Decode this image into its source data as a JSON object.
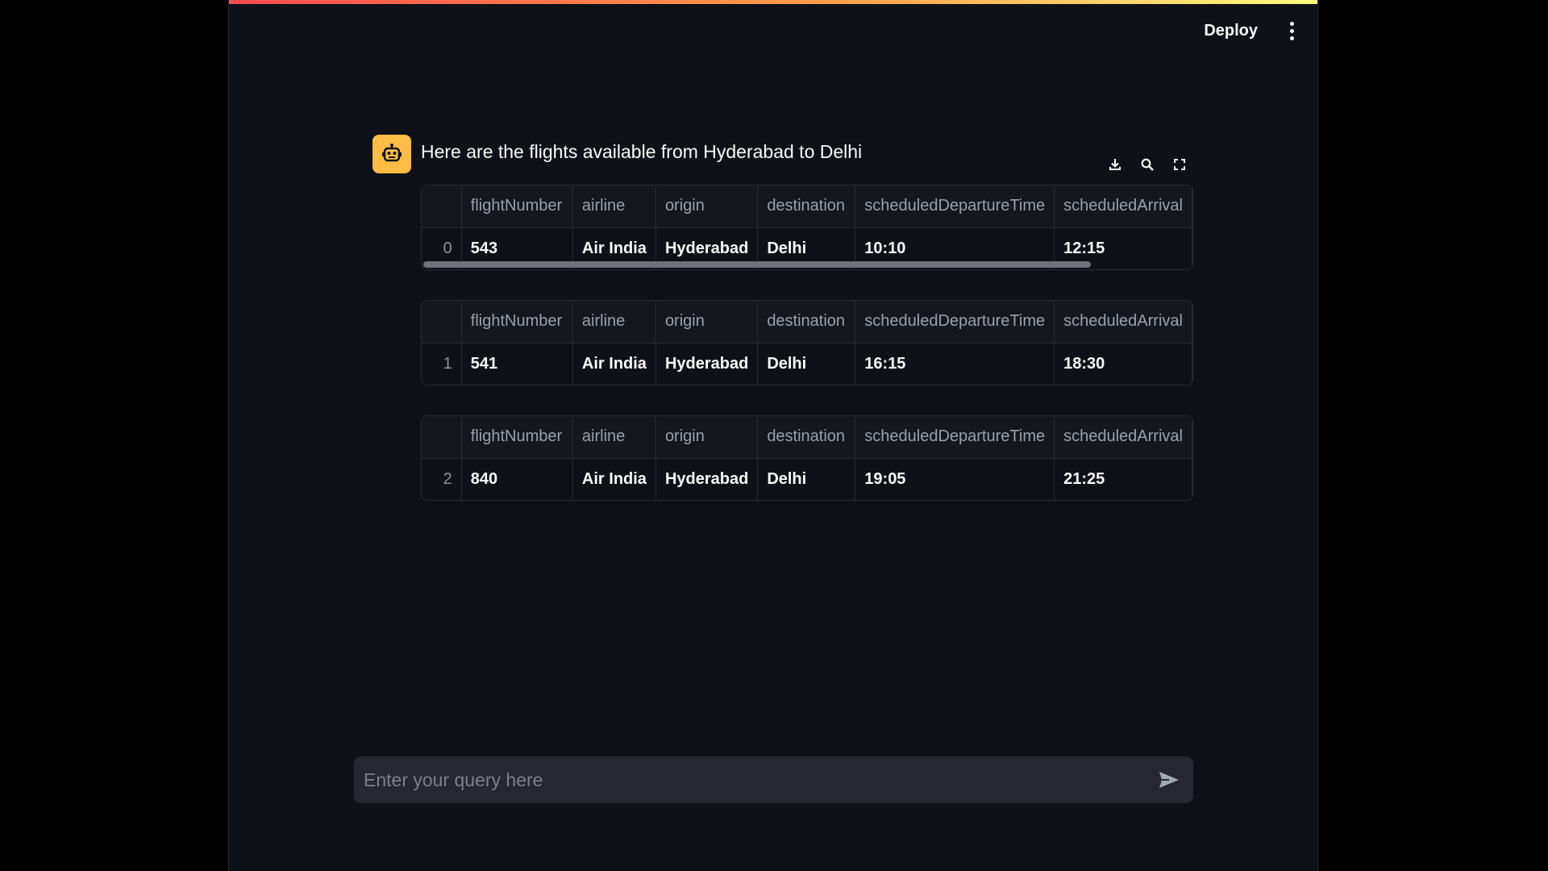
{
  "header": {
    "deploy_label": "Deploy",
    "menu_icon": "kebab-menu-icon"
  },
  "message": {
    "avatar_icon": "robot-icon",
    "text": "Here are the flights available from Hyderabad to Delhi"
  },
  "dataframe_toolbar": {
    "icons": [
      "download-icon",
      "search-icon",
      "fullscreen-icon"
    ]
  },
  "tables": [
    {
      "columns": [
        "",
        "flightNumber",
        "airline",
        "origin",
        "destination",
        "scheduledDepartureTime",
        "scheduledArrival"
      ],
      "row": [
        "0",
        "543",
        "Air India",
        "Hyderabad",
        "Delhi",
        "10:10",
        "12:15"
      ]
    },
    {
      "columns": [
        "",
        "flightNumber",
        "airline",
        "origin",
        "destination",
        "scheduledDepartureTime",
        "scheduledArrival"
      ],
      "row": [
        "1",
        "541",
        "Air India",
        "Hyderabad",
        "Delhi",
        "16:15",
        "18:30"
      ]
    },
    {
      "columns": [
        "",
        "flightNumber",
        "airline",
        "origin",
        "destination",
        "scheduledDepartureTime",
        "scheduledArrival"
      ],
      "row": [
        "2",
        "840",
        "Air India",
        "Hyderabad",
        "Delhi",
        "19:05",
        "21:25"
      ]
    }
  ],
  "chat_input": {
    "placeholder": "Enter your query here",
    "value": "",
    "send_icon": "send-icon"
  },
  "colors": {
    "background": "#0e1117",
    "accent": "#ffbd45",
    "decoration_start": "#ff4b4b",
    "decoration_end": "#fffd80"
  }
}
